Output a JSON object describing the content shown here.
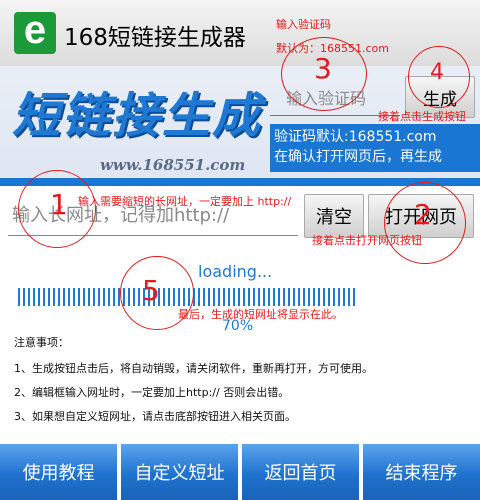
{
  "app": {
    "logo_letter": "e",
    "title": "168短链接生成器"
  },
  "banner": {
    "title": "短链接生成",
    "url": "www.168551.com"
  },
  "code": {
    "placeholder": "输入验证码",
    "generate_label": "生成",
    "info_line1": "验证码默认:168551.com",
    "info_line2": "在确认打开网页后，再生成"
  },
  "url": {
    "placeholder": "输入长网址，记得加http://",
    "clear_label": "清空",
    "open_label": "打开网页"
  },
  "progress": {
    "loading_text": "loading...",
    "value": 70,
    "label": "70%"
  },
  "notes": {
    "title": "注意事项：",
    "items": [
      "1、生成按钮点击后，将自动销毁，请关闭软件，重新再打开，方可使用。",
      "2、编辑框输入网址时，一定要加上http:// 否则会出错。",
      "3、如果想自定义短网址，请点击底部按钮进入相关页面。"
    ]
  },
  "bottom": {
    "tutorial": "使用教程",
    "custom": "自定义短址",
    "home": "返回首页",
    "exit": "结束程序"
  },
  "annotations": {
    "code_hint1": "输入验证码",
    "code_hint2": "默认为：168551.com",
    "generate_hint": "接着点击生成按钮",
    "url_hint": "输入需要缩短的长网址，一定要加上 http://",
    "open_hint": "接着点击打开网页按钮",
    "result_hint": "最后，生成的短网址将显示在此。",
    "num1": "1",
    "num2": "2",
    "num3": "3",
    "num4": "4",
    "num5": "5"
  },
  "colors": {
    "accent": "#1f78d1",
    "annotation": "#e21b1b",
    "logo": "#1a9a38"
  }
}
